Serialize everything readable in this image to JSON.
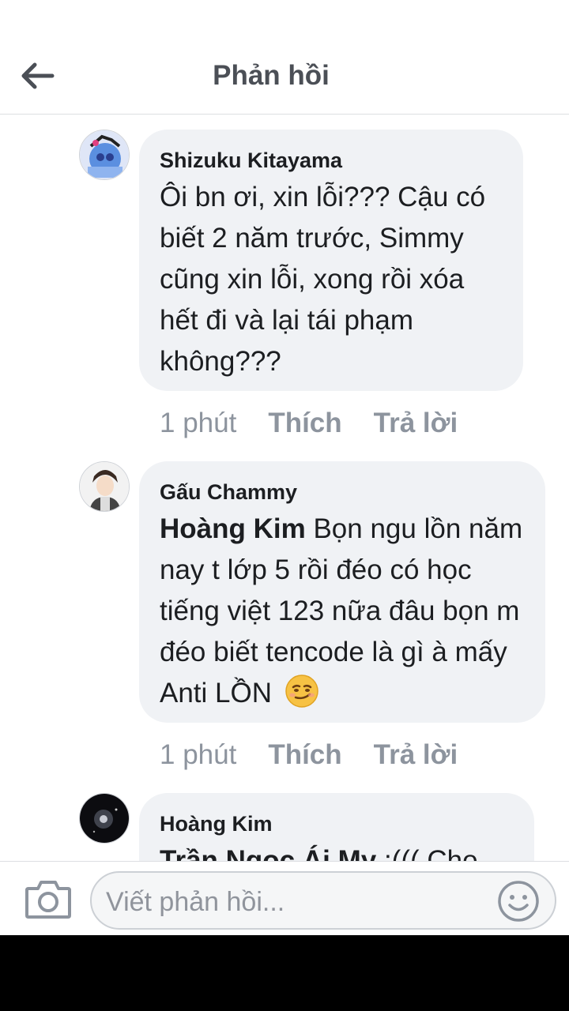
{
  "header": {
    "title": "Phản hồi",
    "back_icon": "arrow-left-icon"
  },
  "comments": [
    {
      "author": "Shizuku Kitayama",
      "mention": "",
      "text": "Ôi bn ơi, xin lỗi??? Cậu có biết 2 năm trước, Simmy cũng xin lỗi, xong rồi xóa hết đi và lại tái phạm không???",
      "time": "1 phút",
      "like": "Thích",
      "reply": "Trả lời"
    },
    {
      "author": "Gấu Chammy",
      "mention": "Hoàng Kim",
      "text": " Bọn ngu lồn năm nay t lớp 5 rồi đéo có học tiếng việt 123 nữa đâu bọn m đéo biết tencode là gì à mấy Anti LỒN",
      "emoji": "smirk-emoji",
      "time": "1 phút",
      "like": "Thích",
      "reply": "Trả lời"
    },
    {
      "author": "Hoàng Kim",
      "mention": "Trần Ngọc Ái My",
      "text": " :((( Cho"
    }
  ],
  "composer": {
    "placeholder": "Viết phản hồi...",
    "camera_icon": "camera-icon",
    "emoji_icon": "smiley-icon"
  },
  "colors": {
    "bubble": "#f0f2f5",
    "meta": "#8d949e",
    "title": "#4b4f56"
  }
}
